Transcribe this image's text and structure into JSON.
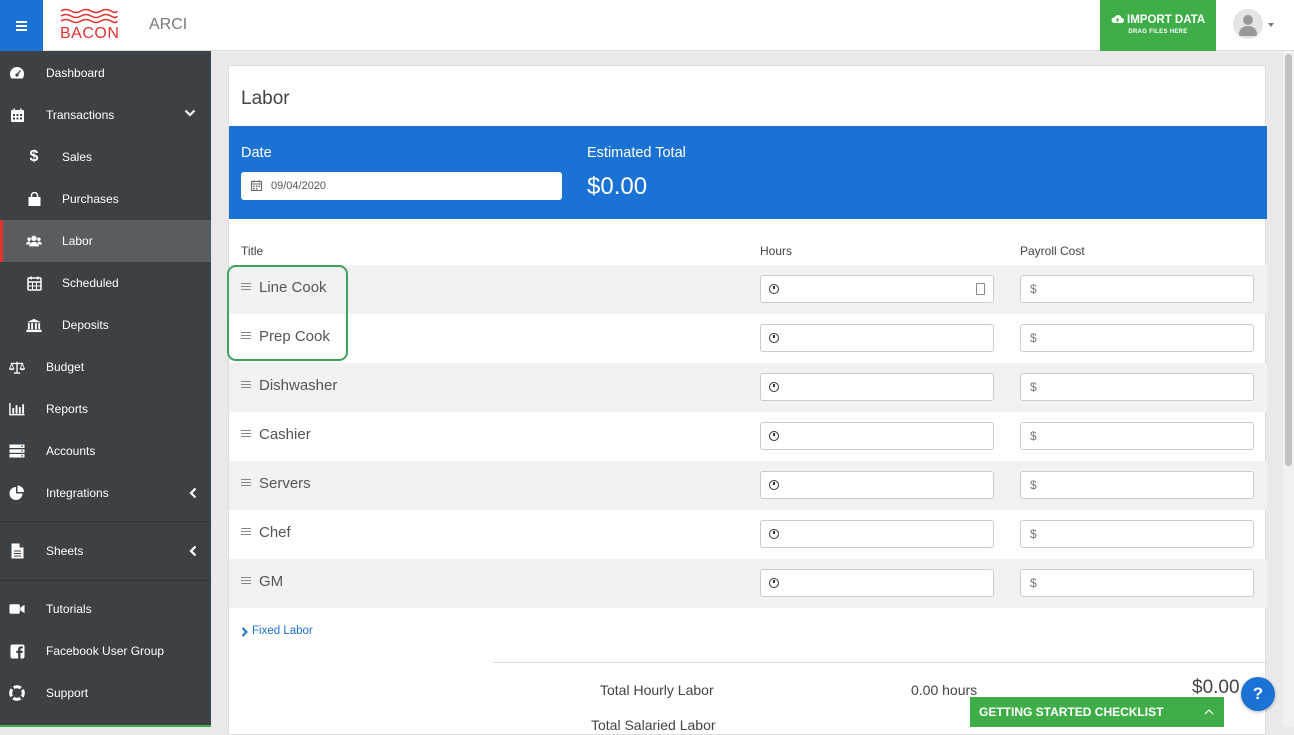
{
  "header": {
    "logo_text": "BACON",
    "org_name": "ARCI",
    "import_label": "IMPORT DATA",
    "import_sub": "DRAG FILES HERE"
  },
  "sidebar": {
    "items": [
      {
        "label": "Dashboard",
        "icon": "dashboard-icon"
      },
      {
        "label": "Transactions",
        "icon": "calendar-icon"
      },
      {
        "label": "Sales",
        "icon": "dollar-icon"
      },
      {
        "label": "Purchases",
        "icon": "shopping-bag-icon"
      },
      {
        "label": "Labor",
        "icon": "users-icon"
      },
      {
        "label": "Scheduled",
        "icon": "calendar-grid-icon"
      },
      {
        "label": "Deposits",
        "icon": "bank-icon"
      },
      {
        "label": "Budget",
        "icon": "balance-scale-icon"
      },
      {
        "label": "Reports",
        "icon": "bar-chart-icon"
      },
      {
        "label": "Accounts",
        "icon": "server-icon"
      },
      {
        "label": "Integrations",
        "icon": "pie-chart-icon"
      },
      {
        "label": "Sheets",
        "icon": "file-icon"
      },
      {
        "label": "Tutorials",
        "icon": "video-camera-icon"
      },
      {
        "label": "Facebook User Group",
        "icon": "facebook-icon"
      },
      {
        "label": "Support",
        "icon": "lifebuoy-icon"
      }
    ],
    "active": "Labor"
  },
  "page": {
    "title": "Labor",
    "date_label": "Date",
    "date_value": "09/04/2020",
    "estimated_label": "Estimated Total",
    "estimated_value": "$0.00"
  },
  "table": {
    "headers": {
      "title": "Title",
      "hours": "Hours",
      "cost": "Payroll Cost"
    },
    "currency_symbol": "$",
    "rows": [
      {
        "title": "Line Cook"
      },
      {
        "title": "Prep Cook"
      },
      {
        "title": "Dishwasher"
      },
      {
        "title": "Cashier"
      },
      {
        "title": "Servers"
      },
      {
        "title": "Chef"
      },
      {
        "title": "GM"
      }
    ]
  },
  "summary": {
    "fixed_link": "Fixed Labor",
    "hourly_label": "Total Hourly Labor",
    "hourly_hours": "0.00 hours",
    "hourly_total": "$0.00",
    "salaried_label": "Total Salaried Labor"
  },
  "footer": {
    "checklist_label": "GETTING STARTED CHECKLIST",
    "help_label": "?"
  },
  "colors": {
    "primary": "#1a73d4",
    "sidebar": "#3c4146",
    "accent_green": "#3fae49",
    "brand_red": "#e2332f",
    "highlight": "#3fa35a"
  }
}
